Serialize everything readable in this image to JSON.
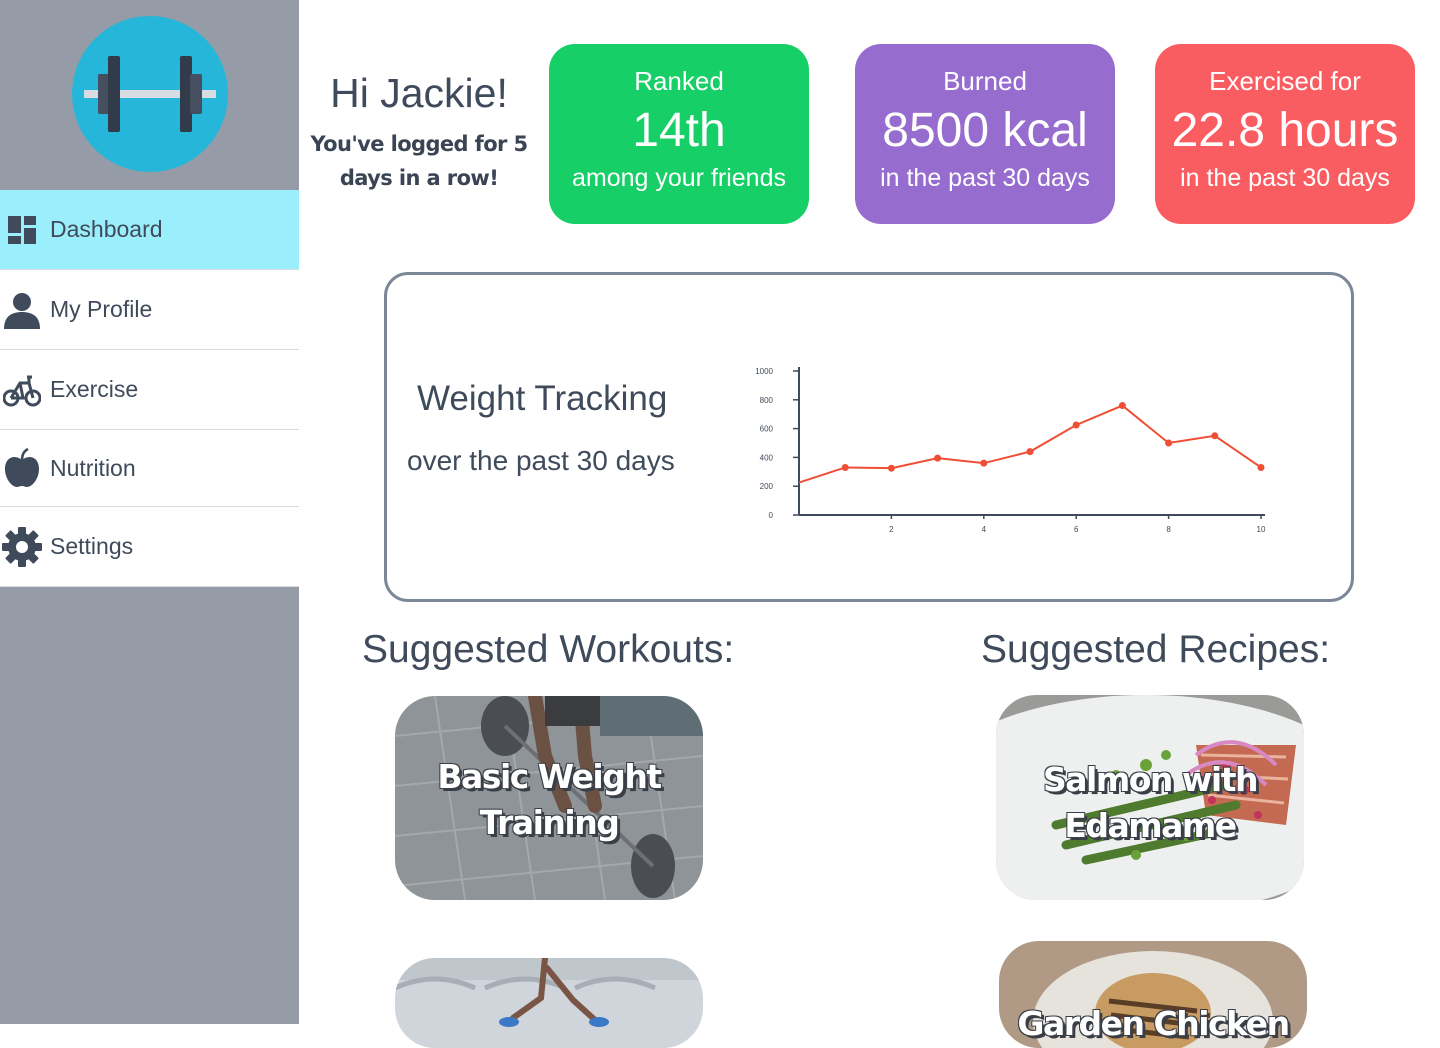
{
  "sidebar": {
    "logo_icon": "barbell-icon",
    "items": [
      {
        "label": "Dashboard",
        "icon": "dashboard-icon",
        "active": true
      },
      {
        "label": "My Profile",
        "icon": "user-icon"
      },
      {
        "label": "Exercise",
        "icon": "bike-icon"
      },
      {
        "label": "Nutrition",
        "icon": "apple-icon"
      },
      {
        "label": "Settings",
        "icon": "gear-icon"
      }
    ]
  },
  "greeting": {
    "title": "Hi Jackie!",
    "streak": "You've logged for 5 days in a row!"
  },
  "stats": [
    {
      "top": "Ranked",
      "value": "14th",
      "bottom": "among your friends",
      "color": "#16cf66"
    },
    {
      "top": "Burned",
      "value": "8500 kcal",
      "bottom": "in the past 30 days",
      "color": "#976ccf"
    },
    {
      "top": "Exercised for",
      "value": "22.8 hours",
      "bottom": "in the past 30 days",
      "color": "#fa5d61"
    }
  ],
  "weight": {
    "title": "Weight Tracking",
    "subtitle": "over the past 30 days"
  },
  "chart_data": {
    "type": "line",
    "x": [
      0,
      1,
      2,
      3,
      4,
      5,
      6,
      7,
      8,
      9,
      10
    ],
    "series": [
      {
        "values": [
          225,
          330,
          325,
          395,
          360,
          440,
          625,
          760,
          500,
          550,
          330
        ],
        "color": "#ef4e35"
      }
    ],
    "xticks": [
      "2",
      "4",
      "6",
      "8",
      "10"
    ],
    "yticks": [
      "0",
      "200",
      "400",
      "600",
      "800",
      "1000"
    ],
    "xlim": [
      0,
      10
    ],
    "ylim": [
      0,
      1000
    ],
    "grid": false
  },
  "workouts": {
    "title": "Suggested Workouts:",
    "items": [
      {
        "label": "Basic Weight Training"
      },
      {
        "label": ""
      }
    ]
  },
  "recipes": {
    "title": "Suggested Recipes:",
    "items": [
      {
        "label": "Salmon with Edamame"
      },
      {
        "label": "Garden Chicken"
      }
    ]
  }
}
